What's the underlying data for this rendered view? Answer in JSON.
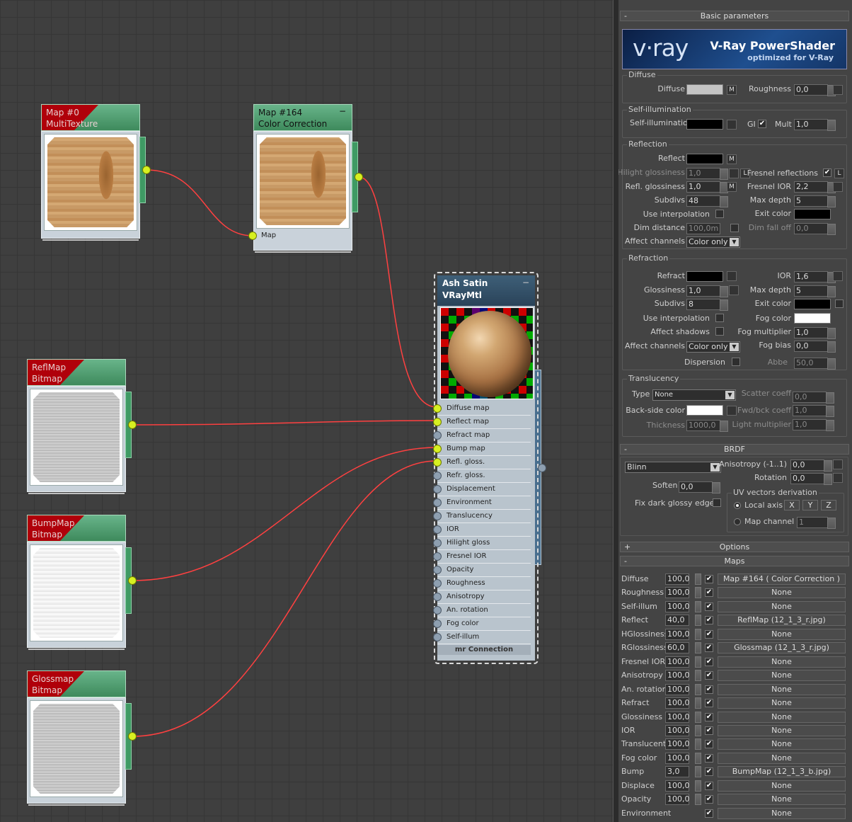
{
  "nodes": {
    "multitexture": {
      "title": "Map #0",
      "subtitle": "MultiTexture"
    },
    "colorcorrection": {
      "title": "Map #164",
      "subtitle": "Color Correction",
      "slot_label": "Map",
      "minimize": "−"
    },
    "reflmap": {
      "title": "ReflMap",
      "subtitle": "Bitmap"
    },
    "bumpmap": {
      "title": "BumpMap",
      "subtitle": "Bitmap"
    },
    "glossmap": {
      "title": "Glossmap",
      "subtitle": "Bitmap"
    }
  },
  "material": {
    "name": "Ash Satin",
    "type": "VRayMtl",
    "minimize": "−",
    "slots": [
      "Diffuse map",
      "Reflect map",
      "Refract map",
      "Bump map",
      "Refl. gloss.",
      "Refr. gloss.",
      "Displacement",
      "Environment",
      "Translucency",
      "IOR",
      "Hilight gloss",
      "Fresnel IOR",
      "Opacity",
      "Roughness",
      "Anisotropy",
      "An. rotation",
      "Fog color",
      "Self-illum"
    ],
    "connected_slots": [
      "Diffuse map",
      "Reflect map",
      "Bump map",
      "Refl. gloss."
    ],
    "mr_connection": "mr Connection"
  },
  "panel": {
    "basic_title": "Basic parameters",
    "banner": {
      "logo": "v·ray",
      "line1": "V-Ray PowerShader",
      "line2": "optimized for V-Ray"
    },
    "diffuse": {
      "group": "Diffuse",
      "label": "Diffuse",
      "color": "#c4c4c4",
      "m": "M",
      "roughness_label": "Roughness",
      "roughness": "0,0"
    },
    "selfillum": {
      "group": "Self-illumination",
      "label": "Self-illumination",
      "color": "#000000",
      "gi": "GI",
      "mult_label": "Mult",
      "mult": "1,0"
    },
    "reflection": {
      "group": "Reflection",
      "reflect": "Reflect",
      "reflect_color": "#000000",
      "m": "M",
      "hilight": "Hilight glossiness",
      "hilight_val": "1,0",
      "l": "L",
      "fresnel": "Fresnel reflections",
      "refl_gloss": "Refl. glossiness",
      "refl_gloss_val": "1,0",
      "fresnel_ior": "Fresnel IOR",
      "fresnel_ior_val": "2,2",
      "subdivs": "Subdivs",
      "subdivs_val": "48",
      "max_depth": "Max depth",
      "max_depth_val": "5",
      "use_interp": "Use interpolation",
      "exit_color": "Exit color",
      "exit_color_val": "#000000",
      "dim_dist": "Dim distance",
      "dim_dist_val": "100,0m",
      "dim_falloff": "Dim fall off",
      "dim_falloff_val": "0,0",
      "affect": "Affect channels",
      "affect_val": "Color only"
    },
    "refraction": {
      "group": "Refraction",
      "refract": "Refract",
      "refract_color": "#000000",
      "ior": "IOR",
      "ior_val": "1,6",
      "gloss": "Glossiness",
      "gloss_val": "1,0",
      "max_depth": "Max depth",
      "max_depth_val": "5",
      "subdivs": "Subdivs",
      "subdivs_val": "8",
      "exit_color": "Exit color",
      "exit_color_val": "#000000",
      "use_interp": "Use interpolation",
      "fog_color": "Fog color",
      "fog_color_val": "#ffffff",
      "affect_shadows": "Affect shadows",
      "fog_mult": "Fog multiplier",
      "fog_mult_val": "1,0",
      "affect": "Affect channels",
      "affect_val": "Color only",
      "fog_bias": "Fog bias",
      "fog_bias_val": "0,0",
      "dispersion": "Dispersion",
      "abbe": "Abbe",
      "abbe_val": "50,0"
    },
    "translucency": {
      "group": "Translucency",
      "type": "Type",
      "type_val": "None",
      "scatter": "Scatter coeff",
      "scatter_val": "0,0",
      "back": "Back-side color",
      "back_color": "#ffffff",
      "fwd": "Fwd/bck coeff",
      "fwd_val": "1,0",
      "thickness": "Thickness",
      "thickness_val": "1000,0",
      "light_mult": "Light multiplier",
      "light_mult_val": "1,0"
    },
    "brdf": {
      "title": "BRDF",
      "type_val": "Blinn",
      "aniso": "Anisotropy (-1..1)",
      "aniso_val": "0,0",
      "rotation": "Rotation",
      "rotation_val": "0,0",
      "soften": "Soften",
      "soften_val": "0,0",
      "fix_dark": "Fix dark glossy edges",
      "uv_group": "UV vectors derivation",
      "local_axis": "Local axis",
      "x": "X",
      "y": "Y",
      "z": "Z",
      "map_channel": "Map channel",
      "map_channel_val": "1"
    },
    "options_title": "Options",
    "maps_title": "Maps",
    "collapse_sign": "-",
    "expand_sign": "+",
    "check": "✔",
    "maps": [
      {
        "name": "Diffuse",
        "amount": "100,0",
        "map": "Map #164  ( Color Correction )"
      },
      {
        "name": "Roughness",
        "amount": "100,0",
        "map": "None"
      },
      {
        "name": "Self-illum",
        "amount": "100,0",
        "map": "None"
      },
      {
        "name": "Reflect",
        "amount": "40,0",
        "map": "ReflMap (12_1_3_r.jpg)"
      },
      {
        "name": "HGlossiness",
        "amount": "100,0",
        "map": "None"
      },
      {
        "name": "RGlossiness",
        "amount": "60,0",
        "map": "Glossmap (12_1_3_r.jpg)"
      },
      {
        "name": "Fresnel IOR",
        "amount": "100,0",
        "map": "None"
      },
      {
        "name": "Anisotropy",
        "amount": "100,0",
        "map": "None"
      },
      {
        "name": "An. rotation",
        "amount": "100,0",
        "map": "None"
      },
      {
        "name": "Refract",
        "amount": "100,0",
        "map": "None"
      },
      {
        "name": "Glossiness",
        "amount": "100,0",
        "map": "None"
      },
      {
        "name": "IOR",
        "amount": "100,0",
        "map": "None"
      },
      {
        "name": "Translucent",
        "amount": "100,0",
        "map": "None"
      },
      {
        "name": "Fog color",
        "amount": "100,0",
        "map": "None"
      },
      {
        "name": "Bump",
        "amount": "3,0",
        "map": "BumpMap (12_1_3_b.jpg)"
      },
      {
        "name": "Displace",
        "amount": "100,0",
        "map": "None"
      },
      {
        "name": "Opacity",
        "amount": "100,0",
        "map": "None"
      },
      {
        "name": "Environment",
        "amount": "",
        "map": "None"
      }
    ]
  }
}
